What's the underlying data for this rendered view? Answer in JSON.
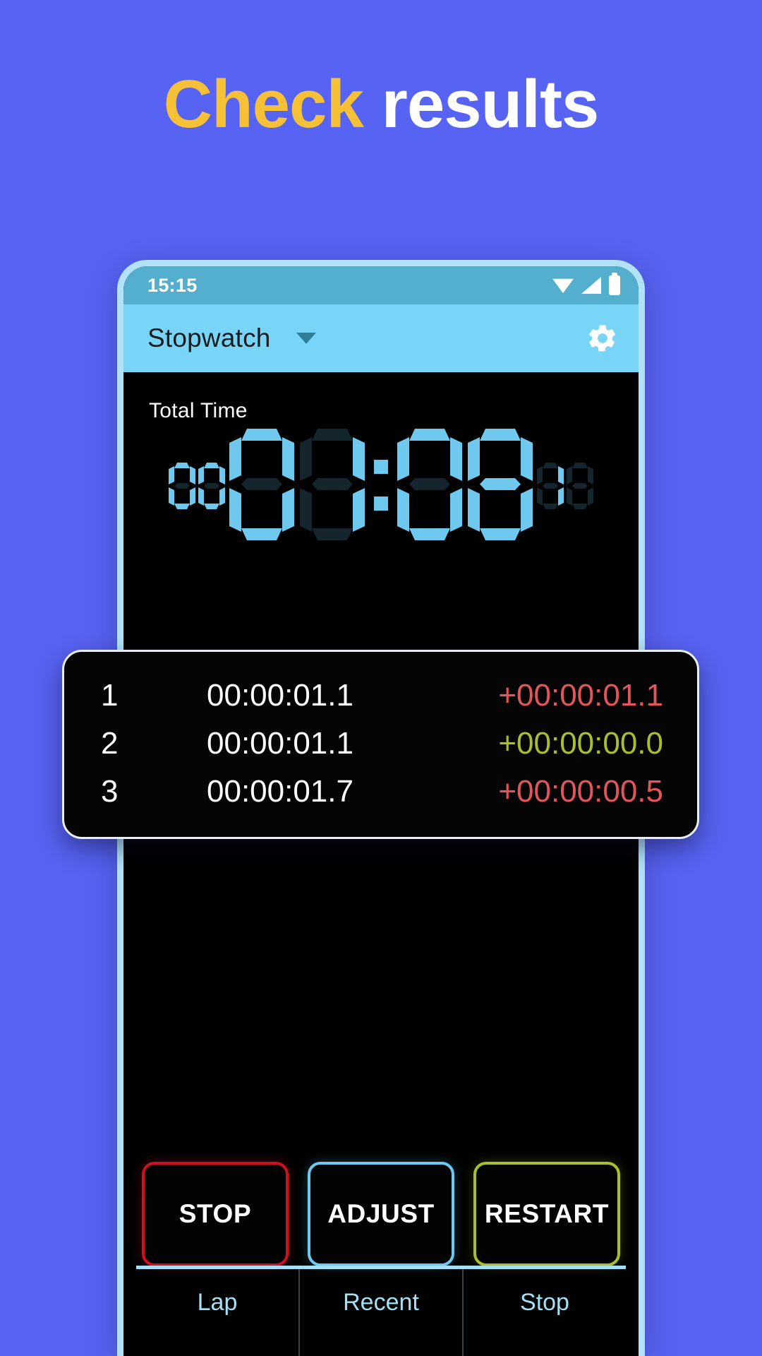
{
  "headline": {
    "accent_word": "Check",
    "plain_word": "results",
    "accent_color": "#f6c137",
    "plain_color": "#ffffff"
  },
  "background_color": "#5763f2",
  "phone": {
    "frame_color": "#b2e2f8",
    "statusbar": {
      "time": "15:15",
      "background": "#54aecd",
      "icons": [
        "wifi-icon",
        "signal-icon",
        "battery-icon"
      ]
    },
    "appbar": {
      "title": "Stopwatch",
      "background": "#79d5f7",
      "title_color": "#181c1e",
      "dropdown_icon": "chevron-down-icon",
      "settings_icon": "gear-icon"
    },
    "timer": {
      "label": "Total Time",
      "segment_color": "#6fc9ef",
      "segment_off_color": "#14252d",
      "hours_small": [
        {
          "value": "0",
          "lit": true
        },
        {
          "value": "0",
          "lit": true
        }
      ],
      "main": [
        {
          "value": "0",
          "lit": true
        },
        {
          "value": "1",
          "lit": true
        }
      ],
      "main2": [
        {
          "value": "0",
          "lit": true
        },
        {
          "value": "8",
          "lit": true
        }
      ],
      "fraction_small": [
        {
          "value": "1",
          "lit": true
        },
        {
          "value": "8",
          "lit": false
        }
      ],
      "display_text": "00 01:08 18"
    },
    "laps": {
      "columns": [
        "#",
        "time",
        "delta"
      ],
      "rows": [
        {
          "index": "1",
          "time": "00:00:01.1",
          "delta": "+00:00:01.1",
          "delta_color": "#e2565b"
        },
        {
          "index": "2",
          "time": "00:00:01.1",
          "delta": "+00:00:00.0",
          "delta_color": "#a8bf30"
        },
        {
          "index": "3",
          "time": "00:00:01.7",
          "delta": "+00:00:00.5",
          "delta_color": "#e2565b"
        }
      ]
    },
    "actions": [
      {
        "label": "STOP",
        "accent": "#cf1020"
      },
      {
        "label": "ADJUST",
        "accent": "#6fc9ef"
      },
      {
        "label": "RESTART",
        "accent": "#a8bf30"
      }
    ],
    "bottom_tabs": [
      {
        "label": "Lap"
      },
      {
        "label": "Recent"
      },
      {
        "label": "Stop"
      }
    ]
  }
}
